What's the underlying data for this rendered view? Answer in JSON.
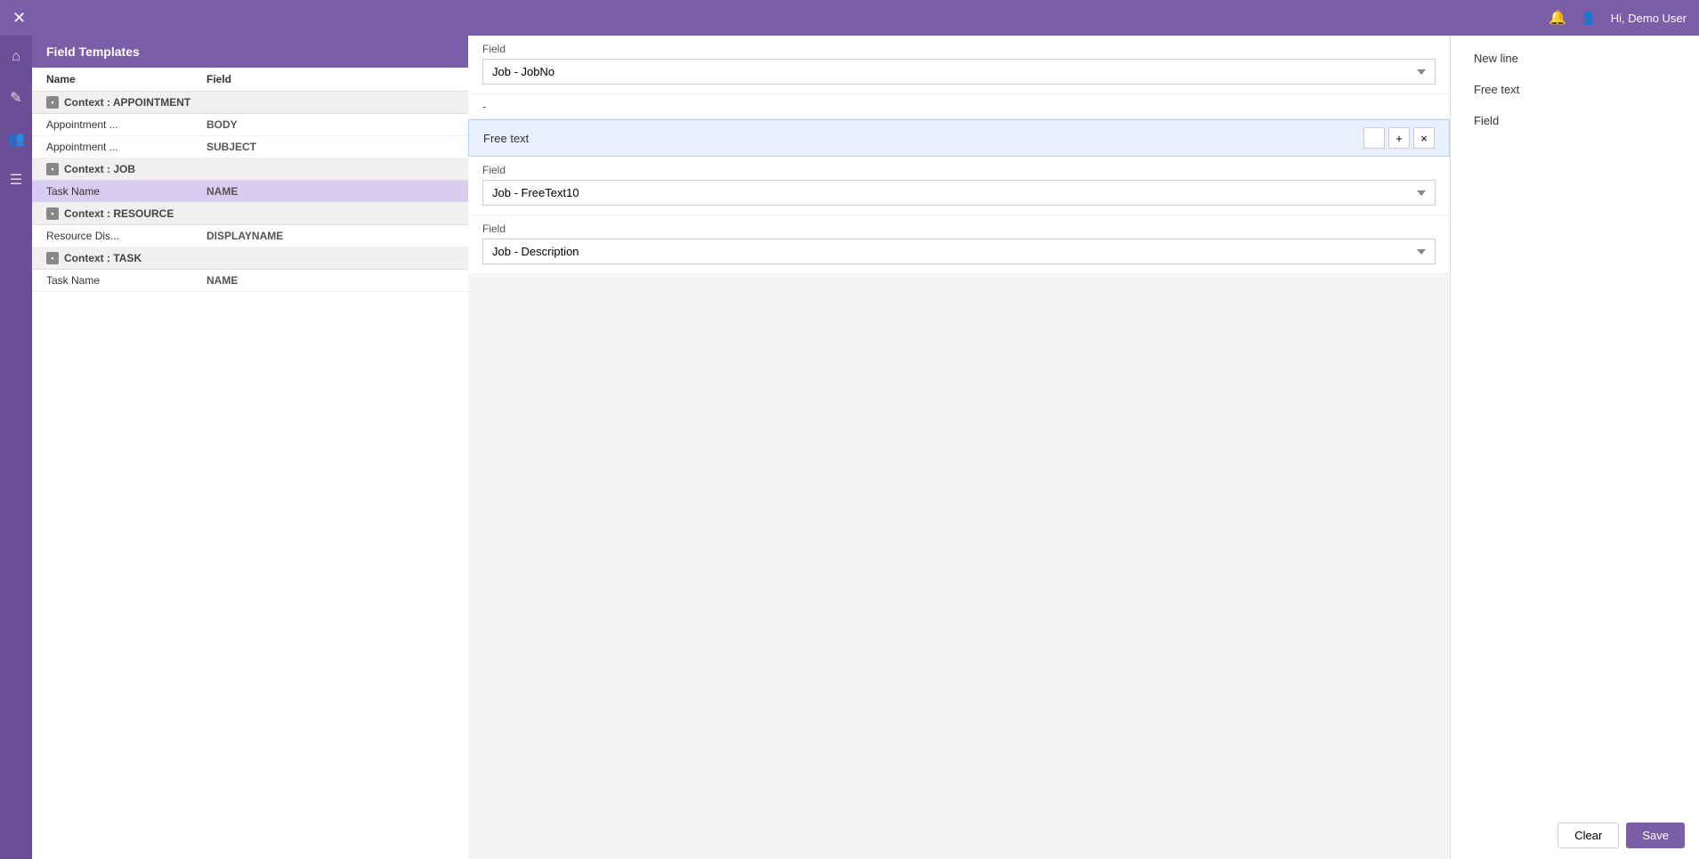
{
  "topbar": {
    "close_label": "✕",
    "bell_label": "🔔",
    "user_label": "Hi, Demo User"
  },
  "sidebar": {
    "icons": [
      "⌂",
      "✎",
      "👥",
      "☰"
    ]
  },
  "left_panel": {
    "title": "Field Templates",
    "columns": {
      "name": "Name",
      "field": "Field"
    },
    "contexts": [
      {
        "label": "Context : APPOINTMENT",
        "rows": [
          {
            "name": "Appointment ...",
            "field": "BODY"
          },
          {
            "name": "Appointment ...",
            "field": "SUBJECT"
          }
        ]
      },
      {
        "label": "Context : JOB",
        "rows": [
          {
            "name": "Task Name",
            "field": "NAME",
            "selected": true
          }
        ]
      },
      {
        "label": "Context : RESOURCE",
        "rows": [
          {
            "name": "Resource Dis...",
            "field": "DISPLAYNAME"
          }
        ]
      },
      {
        "label": "Context : TASK",
        "rows": [
          {
            "name": "Task Name",
            "field": "NAME"
          }
        ]
      }
    ]
  },
  "center_panel": {
    "sections": [
      {
        "type": "field",
        "label": "Field",
        "value": "Job - JobNo"
      },
      {
        "type": "separator",
        "value": "-"
      },
      {
        "type": "freetext",
        "label": "Free text"
      },
      {
        "type": "field",
        "label": "Field",
        "value": "Job - FreeText10"
      },
      {
        "type": "field",
        "label": "Field",
        "value": "Job - Description"
      }
    ]
  },
  "right_panel": {
    "items": [
      {
        "label": "New line"
      },
      {
        "label": "Free text"
      },
      {
        "label": "Field"
      }
    ],
    "clear_label": "Clear",
    "save_label": "Save"
  }
}
